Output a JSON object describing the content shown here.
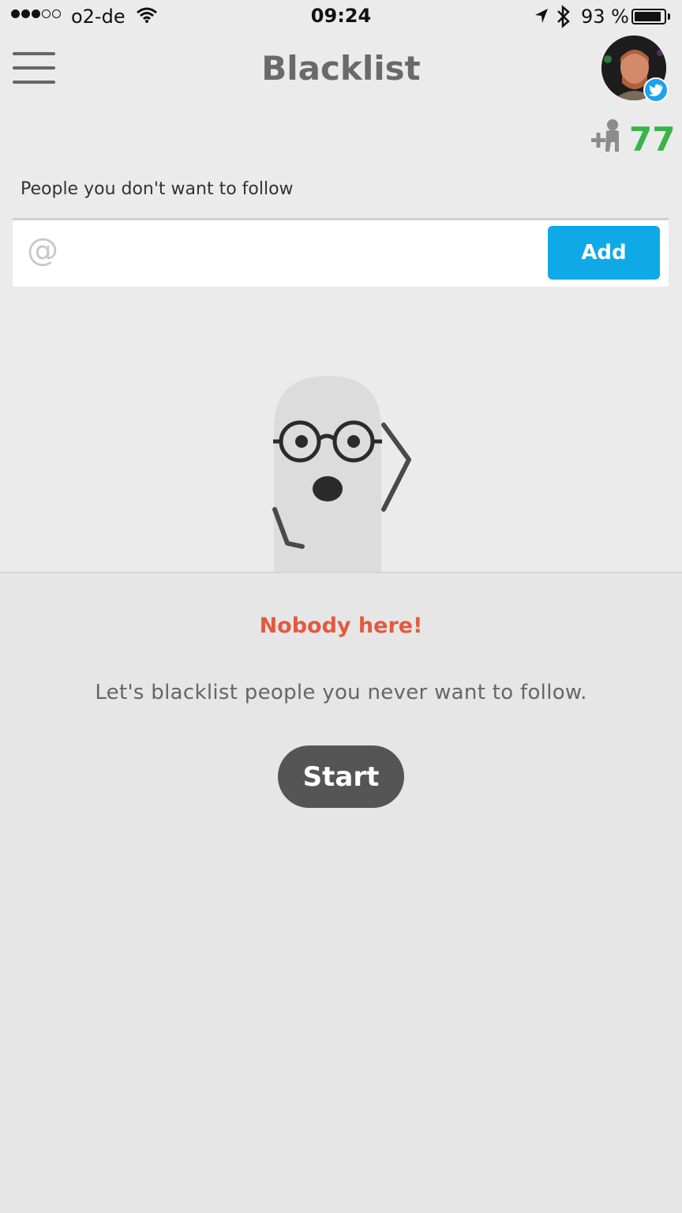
{
  "status_bar": {
    "carrier": "o2-de",
    "time": "09:24",
    "battery_percent": "93 %",
    "battery_level": 0.93,
    "signal_bars_filled": 3,
    "signal_bars_total": 5
  },
  "header": {
    "title": "Blacklist",
    "menu_icon": "hamburger-menu-icon",
    "avatar_badge_icon": "twitter-bird-icon"
  },
  "stats": {
    "follow_icon": "add-person-icon",
    "count": "77",
    "count_color": "#3ab349"
  },
  "blacklist": {
    "section_label": "People you don't want to follow",
    "input_prefix": "@",
    "input_value": "",
    "input_placeholder": "",
    "add_button_label": "Add",
    "add_button_color": "#10a9e8"
  },
  "empty_state": {
    "illustration": "ghost-with-glasses-illustration",
    "title": "Nobody here!",
    "title_color": "#e25a3f",
    "description": "Let's blacklist people you never want to follow.",
    "start_button_label": "Start"
  }
}
